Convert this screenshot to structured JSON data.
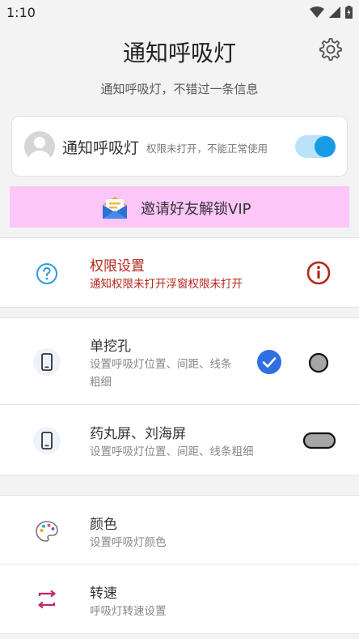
{
  "status_bar": {
    "time": "1:10"
  },
  "header": {
    "title": "通知呼吸灯",
    "subtitle": "通知呼吸灯，不错过一条信息"
  },
  "toggle_card": {
    "name": "通知呼吸灯",
    "status": "权限未打开，不能正常使用",
    "enabled": true
  },
  "vip_banner": {
    "label": "邀请好友解锁VIP"
  },
  "permission": {
    "title": "权限设置",
    "subtitle": "通知权限未打开浮窗权限未打开"
  },
  "single_hole": {
    "title": "单挖孔",
    "subtitle": "设置呼吸灯位置、间距、线条粗细",
    "selected": true
  },
  "pill_notch": {
    "title": "药丸屏、刘海屏",
    "subtitle": "设置呼吸灯位置、间距、线条粗细",
    "selected": false
  },
  "color_row": {
    "title": "颜色",
    "subtitle": "设置呼吸灯颜色"
  },
  "speed_row": {
    "title": "转速",
    "subtitle": "呼吸灯转速设置"
  },
  "colors": {
    "accent_blue": "#1a9be6",
    "check_blue": "#2f6fe4",
    "warning_red": "#b5281c",
    "vip_pink": "#fcc6f9",
    "speed_icon_magenta": "#c2266f"
  }
}
